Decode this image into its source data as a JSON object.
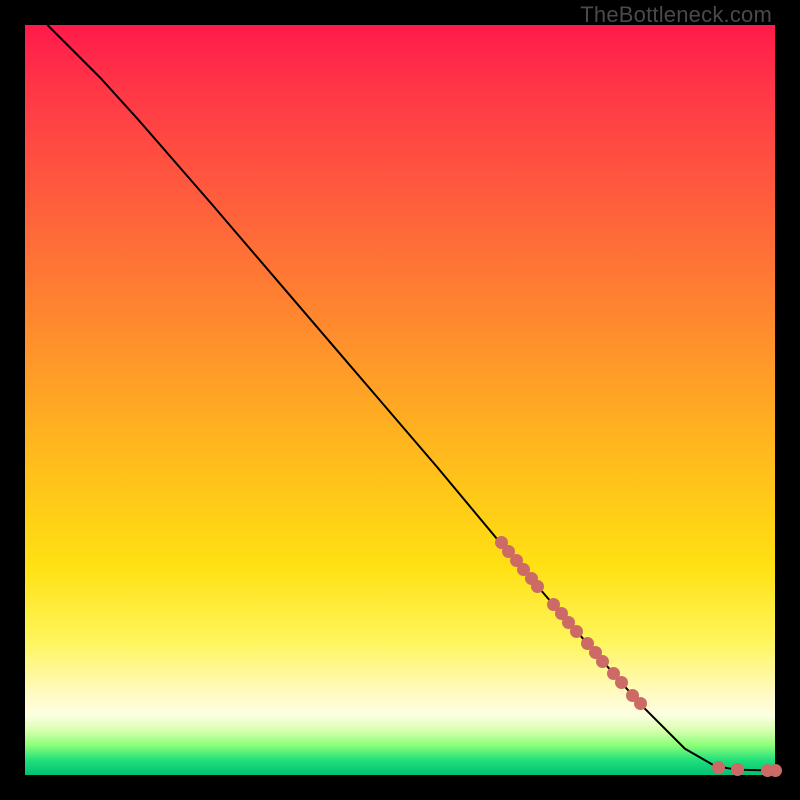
{
  "watermark": "TheBottleneck.com",
  "chart_data": {
    "type": "line",
    "title": "",
    "xlabel": "",
    "ylabel": "",
    "xlim": [
      0,
      100
    ],
    "ylim": [
      0,
      100
    ],
    "grid": false,
    "legend": false,
    "series": [
      {
        "name": "bottleneck-curve",
        "kind": "line",
        "color": "#000000",
        "points_xy": [
          [
            3,
            100
          ],
          [
            6,
            97
          ],
          [
            10,
            93
          ],
          [
            15,
            87.5
          ],
          [
            25,
            76
          ],
          [
            40,
            58.5
          ],
          [
            55,
            41
          ],
          [
            65,
            29
          ],
          [
            75,
            17.5
          ],
          [
            82,
            9.5
          ],
          [
            88,
            3.5
          ],
          [
            92,
            1.2
          ],
          [
            95,
            0.7
          ],
          [
            100,
            0.6
          ]
        ]
      },
      {
        "name": "sample-points",
        "kind": "scatter",
        "color": "#cc6b66",
        "points_xy": [
          [
            63.5,
            31.0
          ],
          [
            64.5,
            29.8
          ],
          [
            65.5,
            28.6
          ],
          [
            66.5,
            27.4
          ],
          [
            67.5,
            26.2
          ],
          [
            68.3,
            25.2
          ],
          [
            70.5,
            22.8
          ],
          [
            71.5,
            21.6
          ],
          [
            72.5,
            20.4
          ],
          [
            73.5,
            19.2
          ],
          [
            75.0,
            17.6
          ],
          [
            76.0,
            16.4
          ],
          [
            77.0,
            15.2
          ],
          [
            78.5,
            13.5
          ],
          [
            79.5,
            12.3
          ],
          [
            81.0,
            10.6
          ],
          [
            82.0,
            9.5
          ],
          [
            92.5,
            1.0
          ],
          [
            95.0,
            0.8
          ],
          [
            99.0,
            0.6
          ],
          [
            100.0,
            0.6
          ]
        ]
      }
    ]
  }
}
